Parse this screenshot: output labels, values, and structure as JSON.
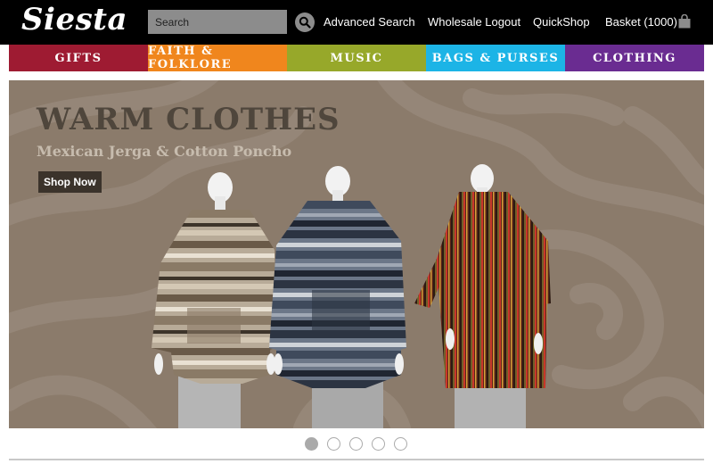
{
  "header": {
    "logo": "Siesta",
    "search_placeholder": "Search",
    "links": [
      "Advanced Search",
      "Wholesale Logout",
      "QuickShop",
      "Basket (1000)"
    ]
  },
  "nav": {
    "items": [
      {
        "label": "GIFTS",
        "color": "#9e1b32"
      },
      {
        "label": "FAITH & FOLKLORE",
        "color": "#f0861d"
      },
      {
        "label": "MUSIC",
        "color": "#97a82a"
      },
      {
        "label": "BAGS & PURSES",
        "color": "#1cb4e6"
      },
      {
        "label": "CLOTHING",
        "color": "#6a2c91"
      }
    ]
  },
  "banner": {
    "title": "WARM CLOTHES",
    "subtitle": "Mexican Jerga & Cotton Poncho",
    "cta": "Shop Now"
  },
  "carousel": {
    "slide_count": 5,
    "active_index": 0
  },
  "icons": {
    "search": "magnifier-icon",
    "basket": "shopping-bag-icon"
  }
}
